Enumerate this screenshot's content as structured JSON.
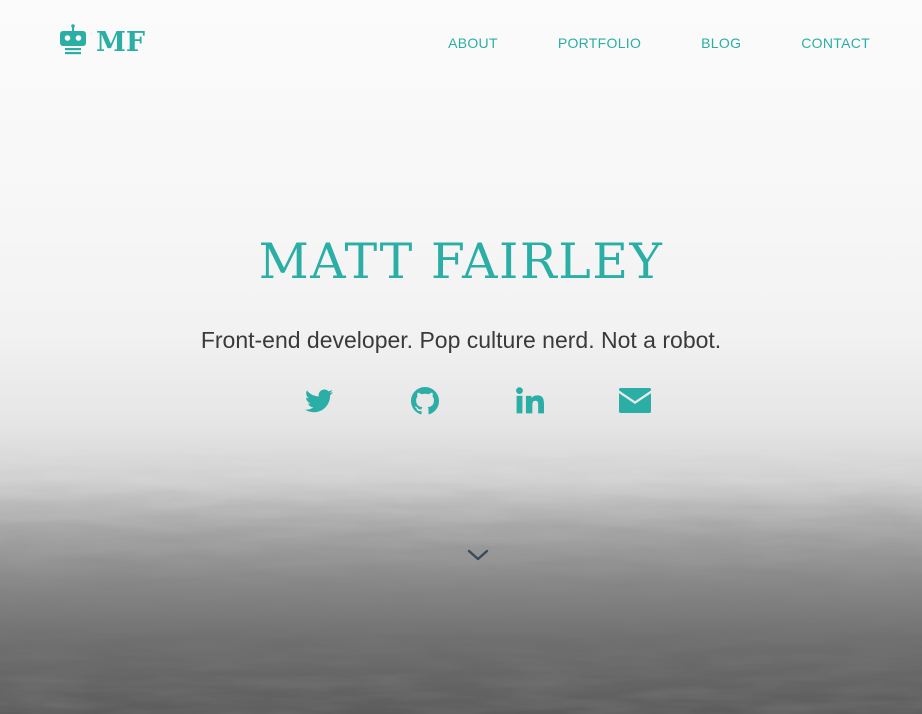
{
  "brand": {
    "logo_text": "MF",
    "logo_icon": "robot-icon",
    "accent_color": "#2aaea5"
  },
  "nav": {
    "items": [
      {
        "label": "ABOUT"
      },
      {
        "label": "PORTFOLIO"
      },
      {
        "label": "BLOG"
      },
      {
        "label": "CONTACT"
      }
    ]
  },
  "hero": {
    "title": "MATT FAIRLEY",
    "tagline": "Front-end developer. Pop culture nerd. Not a robot.",
    "social": [
      {
        "icon": "twitter-icon"
      },
      {
        "icon": "github-icon"
      },
      {
        "icon": "linkedin-icon"
      },
      {
        "icon": "email-icon"
      }
    ],
    "scroll_icon": "chevron-down-icon",
    "scroll_color": "#3a4a5a"
  }
}
